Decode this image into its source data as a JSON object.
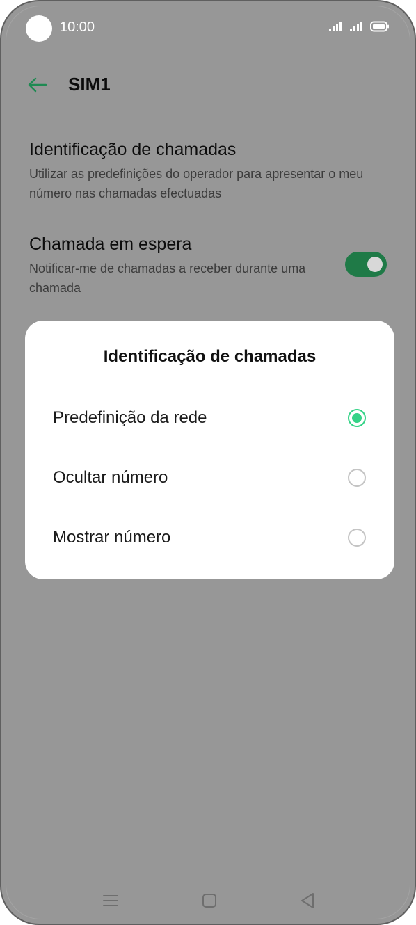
{
  "status_bar": {
    "time": "10:00",
    "icons": [
      "camera-cutout",
      "signal-sim1-icon",
      "signal-sim2-icon",
      "battery-icon"
    ]
  },
  "app_bar": {
    "title": "SIM1",
    "back_icon": "arrow-left-icon",
    "accent_color": "#1f8a52"
  },
  "settings": [
    {
      "title": "Identificação de chamadas",
      "description": "Utilizar as predefinições do operador para apresentar o meu número nas chamadas efectuadas"
    },
    {
      "title": "Chamada em espera",
      "description": "Notificar-me de chamadas a receber durante uma chamada",
      "toggle_on": true
    }
  ],
  "dialog": {
    "title": "Identificação de chamadas",
    "options": [
      {
        "label": "Predefinição da rede",
        "selected": true
      },
      {
        "label": "Ocultar número",
        "selected": false
      },
      {
        "label": "Mostrar número",
        "selected": false
      }
    ],
    "selected_color": "#35d387"
  },
  "nav_bar": {
    "icons": [
      "menu-icon",
      "home-icon",
      "back-triangle-icon"
    ]
  }
}
